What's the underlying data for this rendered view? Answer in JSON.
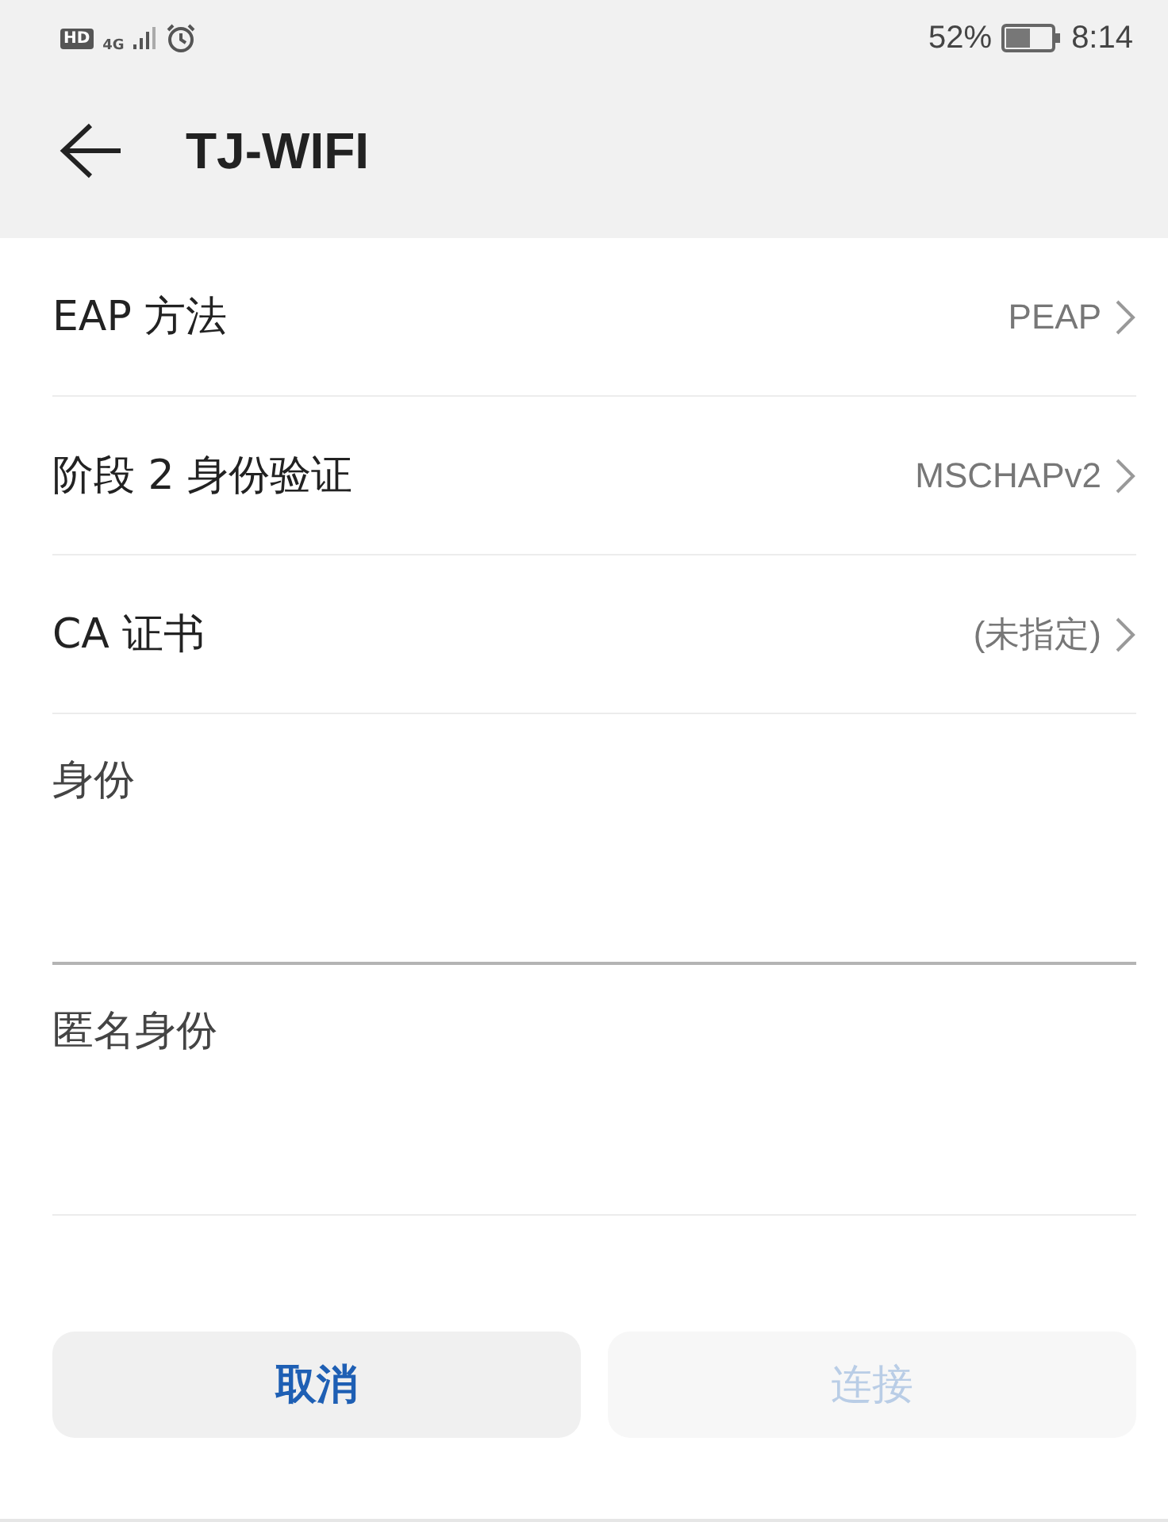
{
  "status_bar": {
    "hd_badge": "HD",
    "network_type": "4G",
    "battery_percent": "52%",
    "time": "8:14"
  },
  "header": {
    "title": "TJ-WIFI"
  },
  "settings": [
    {
      "label": "EAP 方法",
      "value": "PEAP"
    },
    {
      "label": "阶段 2 身份验证",
      "value": "MSCHAPv2"
    },
    {
      "label": "CA 证书",
      "value": "(未指定)"
    }
  ],
  "fields": [
    {
      "label": "身份",
      "focused": true
    },
    {
      "label": "匿名身份",
      "focused": false
    }
  ],
  "buttons": [
    {
      "label": "取消",
      "disabled": false
    },
    {
      "label": "连接",
      "disabled": true
    }
  ]
}
